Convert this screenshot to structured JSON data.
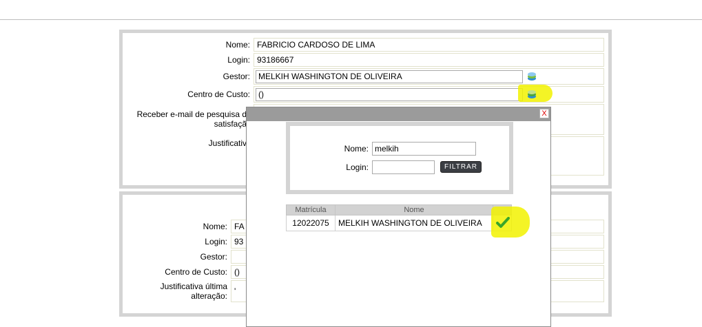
{
  "form1": {
    "nome_label": "Nome:",
    "nome_value": "FABRICIO CARDOSO DE LIMA",
    "login_label": "Login:",
    "login_value": "93186667",
    "gestor_label": "Gestor:",
    "gestor_value": "MELKIH WASHINGTON DE OLIVEIRA",
    "centro_label": "Centro de Custo:",
    "centro_value": "()",
    "receber_label_1": "Receber e-mail de pesquisa d",
    "receber_label_2": "satisfaçã",
    "justificativa_label": "Justificativ"
  },
  "form2": {
    "nome_label": "Nome:",
    "nome_value": "FA",
    "login_label": "Login:",
    "login_value": "93",
    "gestor_label": "Gestor:",
    "centro_label": "Centro de Custo:",
    "centro_value": "()",
    "justificativa_label_1": "Justificativa última",
    "justificativa_label_2": "alteração:",
    "justificativa_value": "'"
  },
  "modal": {
    "close_label": "X",
    "nome_label": "Nome:",
    "nome_value": "melkih",
    "login_label": "Login:",
    "login_value": "",
    "filter_button": "FILTRAR",
    "table": {
      "headers": [
        "Matrícula",
        "Nome"
      ],
      "rows": [
        {
          "matricula": "12022075",
          "nome": "MELKIH WASHINGTON DE OLIVEIRA"
        }
      ]
    }
  },
  "colors": {
    "highlight": "#f2f200",
    "check": "#3aa52a",
    "panel_border": "#d4d4d4",
    "modal_header": "#9b9b9b"
  },
  "icons": [
    "search-layers-icon",
    "check-icon",
    "close-icon"
  ]
}
